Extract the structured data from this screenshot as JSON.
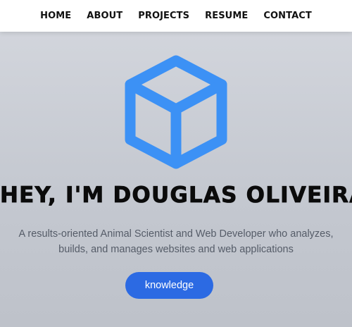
{
  "nav": {
    "items": [
      {
        "label": "HOME"
      },
      {
        "label": "ABOUT"
      },
      {
        "label": "PROJECTS"
      },
      {
        "label": "RESUME"
      },
      {
        "label": "CONTACT"
      }
    ]
  },
  "hero": {
    "logo_icon": "cube-icon",
    "accent_color": "#3c91f5",
    "headline": "HEY, I'M DOUGLAS OLIVEIRA",
    "tagline_line1": "A results-oriented Animal Scientist and Web Developer who analyzes,",
    "tagline_line2": "builds, and manages websites and web applications",
    "cta_label": "knowledge",
    "cta_color": "#2c6ae3"
  }
}
